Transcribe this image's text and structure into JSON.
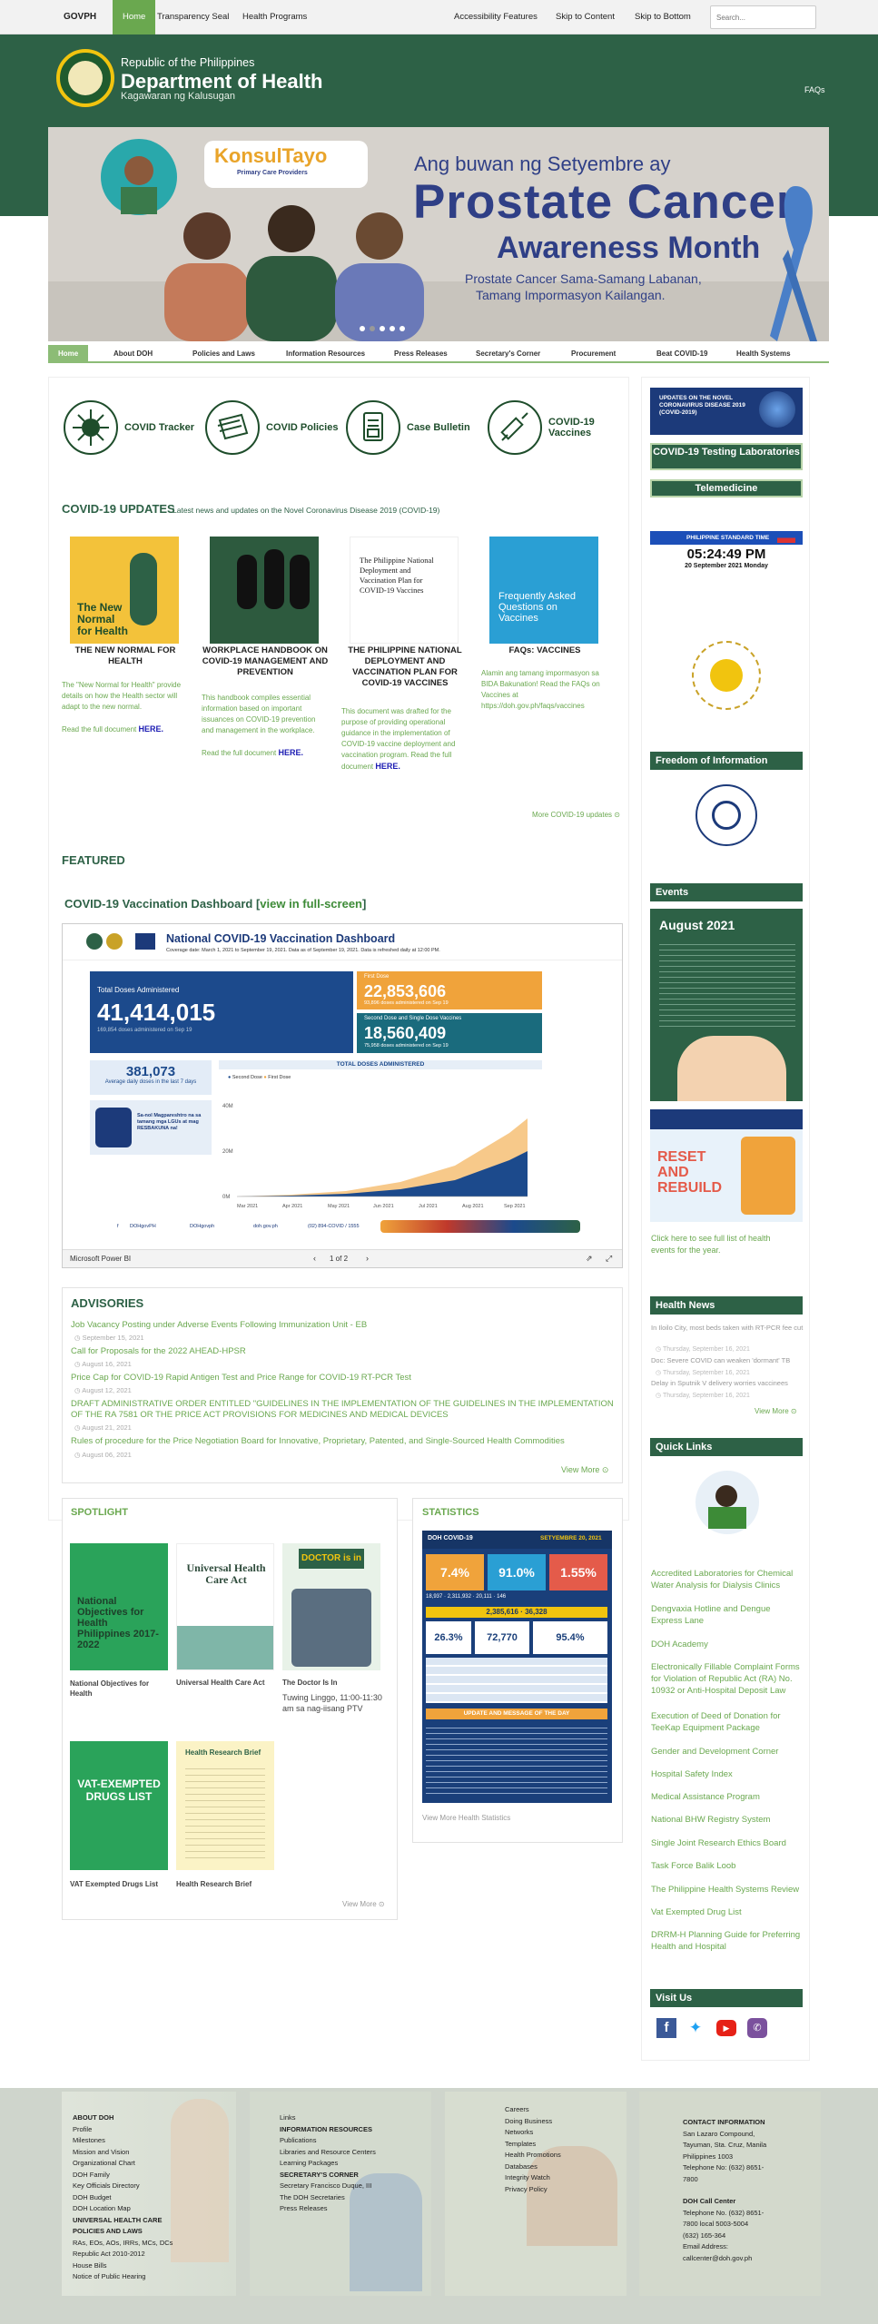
{
  "topbar": {
    "brand": "GOVPH",
    "nav": [
      "Home",
      "Transparency Seal",
      "Health Programs"
    ],
    "right_links": [
      "Accessibility Features",
      "Skip to Content",
      "Skip to Bottom"
    ],
    "search_placeholder": "Search..."
  },
  "header": {
    "republic": "Republic of the Philippines",
    "department": "Department of Health",
    "tagalog": "Kagawaran ng Kalusugan",
    "faqs": "FAQs"
  },
  "banner": {
    "konsul_title": "KonsulTayo",
    "konsul_sub": "Primary Care Providers",
    "line1": "Ang buwan ng Setyembre ay",
    "line2": "Prostate Cancer",
    "line3": "Awareness Month",
    "line4": "Prostate Cancer Sama-Samang Labanan,",
    "line5": "Tamang Impormasyon Kailangan.",
    "slides": 5
  },
  "mainnav": [
    "Home",
    "About DOH",
    "Policies and Laws",
    "Information Resources",
    "Press Releases",
    "Secretary's Corner",
    "Procurement",
    "Beat COVID-19",
    "Health Systems"
  ],
  "quick_tiles": [
    "COVID Tracker",
    "COVID Policies",
    "Case Bulletin",
    "COVID-19 Vaccines"
  ],
  "covid_updates": {
    "title": "COVID-19 UPDATES",
    "subtitle": "Latest news and updates on the Novel Coronavirus Disease 2019 (COVID-19)",
    "cards": [
      {
        "img_text": "The New Normal for Health",
        "title": "THE NEW NORMAL FOR HEALTH",
        "desc": "The \"New Normal for Health\" provide details on how the Health sector will adapt to the new normal.",
        "cta": "Read the full document",
        "link": "HERE."
      },
      {
        "img_text": "",
        "title": "WORKPLACE HANDBOOK ON COVID-19 MANAGEMENT AND PREVENTION",
        "desc": "This handbook compiles essential information based on important issuances on COVID-19 prevention and management in the workplace.",
        "cta": "Read the full document",
        "link": "HERE."
      },
      {
        "img_text": "The Philippine National Deployment and Vaccination Plan for COVID-19 Vaccines",
        "title": "THE PHILIPPINE NATIONAL DEPLOYMENT AND VACCINATION PLAN FOR COVID-19 VACCINES",
        "desc": "This document was drafted for the purpose of providing operational guidance in the implementation of COVID-19 vaccine deployment and vaccination program. Read the full document",
        "cta": "",
        "link": "HERE."
      },
      {
        "img_text": "Frequently Asked Questions on Vaccines",
        "title": "FAQs: VACCINES",
        "desc": "Alamin ang tamang impormasyon sa BIDA Bakunation! Read the FAQs on Vaccines at https://doh.gov.ph/faqs/vaccines",
        "cta": "",
        "link": ""
      }
    ],
    "more": "More COVID-19 updates"
  },
  "featured": {
    "title": "FEATURED",
    "dash_title": "COVID-19 Vaccination Dashboard [",
    "dash_link": "view in full-screen",
    "dash_close": "]"
  },
  "dashboard": {
    "header": "National COVID-19 Vaccination Dashboard",
    "coverage": "Coverage date: March 1, 2021 to September 19, 2021. Data as of September 19, 2021. Data is refreshed daily at 12:00 PM.",
    "total_label": "Total Doses Administered",
    "total": "41,414,015",
    "total_sub": "169,854 doses administered on Sep 19",
    "first_label": "First Dose",
    "first": "22,853,606",
    "first_sub": "93,896 doses administered on Sep 19",
    "second_label": "Second Dose and Single Dose Vaccines",
    "second": "18,560,409",
    "second_sub": "75,958 doses administered on Sep 19",
    "avg": "381,073",
    "avg_sub": "Average daily doses in the last 7 days",
    "chart_title": "TOTAL DOSES ADMINISTERED",
    "legend": [
      "Second Dose",
      "First Dose"
    ],
    "x_ticks": [
      "Mar 2021",
      "Apr 2021",
      "May 2021",
      "Jun 2021",
      "Jul 2021",
      "Aug 2021",
      "Sep 2021"
    ],
    "y_ticks": [
      "40M",
      "20M",
      "0M"
    ],
    "promo": "Sa-nol Magpareshtro na sa tamang mga LGUs at mag RESBAKUNA na!",
    "footer_items": [
      "DOHgovPH",
      "DOHgovph",
      "doh.gov.ph",
      "(02) 894-COVID / 1555"
    ],
    "powerbi": "Microsoft Power BI",
    "pager": "1 of 2"
  },
  "advisories": {
    "title": "ADVISORIES",
    "items": [
      {
        "title": "Job Vacancy Posting under Adverse Events Following Immunization Unit - EB",
        "date": "September 15, 2021"
      },
      {
        "title": "Call for Proposals for the 2022 AHEAD-HPSR",
        "date": "August 16, 2021"
      },
      {
        "title": "Price Cap for COVID-19 Rapid Antigen Test and Price Range for COVID-19 RT-PCR Test",
        "date": "August 12, 2021"
      },
      {
        "title": "DRAFT ADMINISTRATIVE ORDER ENTITLED \"GUIDELINES IN THE IMPLEMENTATION OF THE GUIDELINES IN THE IMPLEMENTATION OF THE RA 7581 OR THE PRICE ACT PROVISIONS FOR MEDICINES AND MEDICAL DEVICES",
        "date": "August 21, 2021"
      },
      {
        "title": "Rules of procedure for the Price Negotiation Board for Innovative, Proprietary, Patented, and Single-Sourced Health Commodities",
        "date": "August 06, 2021"
      }
    ],
    "more": "View More"
  },
  "spotlight": {
    "title": "SPOTLIGHT",
    "items": [
      {
        "img": "National Objectives for Health Philippines 2017-2022",
        "caption": "National Objectives for Health"
      },
      {
        "img": "Universal Health Care Act",
        "caption": "Universal Health Care Act"
      },
      {
        "img": "DOCTOR is in",
        "caption": "The Doctor Is In",
        "extra": "Tuwing Linggo, 11:00-11:30 am sa nag-iisang PTV"
      },
      {
        "img": "VAT-EXEMPTED DRUGS LIST",
        "caption": "VAT Exempted Drugs List"
      },
      {
        "img": "Health Research Brief",
        "caption": "Health Research Brief"
      }
    ],
    "more": "View More"
  },
  "statistics": {
    "title": "STATISTICS",
    "header": "DOH COVID-19",
    "date": "SETYEMBRE 20, 2021",
    "tiles": [
      "7.4%",
      "91.0%",
      "1.55%"
    ],
    "row2": [
      "26.3%",
      "72,770",
      "95.4%"
    ],
    "counts": [
      "18,937",
      "2,311,932",
      "20,111",
      "2,385,616",
      "146",
      "36,328"
    ],
    "update_title": "UPDATE AND MESSAGE OF THE DAY",
    "more": "View More Health Statistics"
  },
  "sidebar": {
    "covid_box": "UPDATES ON THE NOVEL CORONAVIRUS DISEASE 2019 (COVID-2019)",
    "btn_testing": "COVID-19 Testing Laboratories",
    "btn_tele": "Telemedicine",
    "pst_label": "PHILIPPINE STANDARD TIME",
    "pst_time": "05:24:49 PM",
    "pst_date": "20 September 2021 Monday",
    "foi_title": "Freedom of Information",
    "events_title": "Events",
    "events_month": "August 2021",
    "reset_title": "RESET AND REBUILD",
    "events_link": "Click here to see full list of health events for the year.",
    "news_title": "Health News",
    "news": [
      {
        "title": "In Iloilo City, most beds taken with RT-PCR fee cut",
        "date": "Thursday, September 16, 2021"
      },
      {
        "title": "Doc: Severe COVID can weaken 'dormant' TB",
        "date": "Thursday, September 16, 2021"
      },
      {
        "title": "Delay in Sputnik V delivery worries vaccinees",
        "date": "Thursday, September 16, 2021"
      }
    ],
    "news_more": "View More",
    "ql_title": "Quick Links",
    "quick_links": [
      "Accredited Laboratories for Chemical Water Analysis for Dialysis Clinics",
      "Dengvaxia Hotline and Dengue Express Lane",
      "DOH Academy",
      "Electronically Fillable Complaint Forms for Violation of Republic Act (RA) No. 10932 or Anti-Hospital Deposit Law",
      "Execution of Deed of Donation for TeeKap Equipment Package",
      "Gender and Development Corner",
      "Hospital Safety Index",
      "Medical Assistance Program",
      "National BHW Registry System",
      "Single Joint Research Ethics Board",
      "Task Force Balik Loob",
      "The Philippine Health Systems Review",
      "Vat Exempted Drug List",
      "DRRM-H Planning Guide for Preferring Health and Hospital"
    ],
    "visit_title": "Visit Us"
  },
  "footer": {
    "col1": [
      "ABOUT DOH",
      "Profile",
      "Milestones",
      "Mission and Vision",
      "Organizational Chart",
      "DOH Family",
      "Key Officials Directory",
      "DOH Budget",
      "DOH Location Map",
      "UNIVERSAL HEALTH CARE",
      "POLICIES AND LAWS",
      "RAs, EOs, AOs, IRRs, MCs, DCs",
      "Republic Act 2010-2012",
      "House Bills",
      "Notice of Public Hearing"
    ],
    "col2": [
      "Links",
      "INFORMATION RESOURCES",
      "Publications",
      "Libraries and Resource Centers",
      "Learning Packages",
      "SECRETARY'S CORNER",
      "Secretary Francisco Duque, III",
      "The DOH Secretaries",
      "Press Releases"
    ],
    "col3": [
      "Careers",
      "Doing Business",
      "Networks",
      "Templates",
      "Health Promotions",
      "Databases",
      "Integrity Watch",
      "Privacy Policy"
    ],
    "col4": [
      "CONTACT INFORMATION",
      "San Lazaro Compound,",
      "Tayuman, Sta. Cruz, Manila",
      "Philippines 1003",
      "Telephone No: (632) 8651-",
      "7800",
      "",
      "DOH Call Center",
      "Telephone No. (632) 8651-",
      "7800 local 5003-5004",
      "(632) 165-364",
      "Email Address:",
      "callcenter@doh.gov.ph"
    ]
  },
  "colors": {
    "green_dark": "#2d6146",
    "green_light": "#6aa84f",
    "banner_blue": "#2f3f86",
    "dash_blue": "#1c4a8c",
    "dash_orange": "#f0a33b",
    "dash_teal": "#1a6b7d"
  }
}
